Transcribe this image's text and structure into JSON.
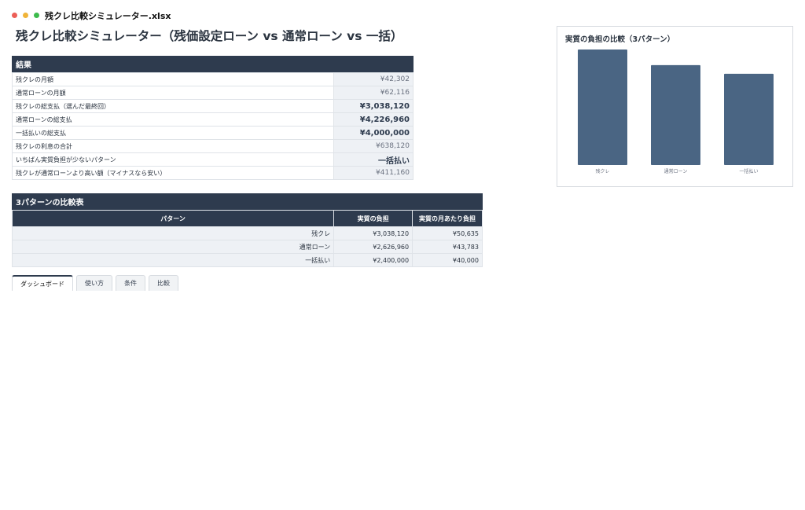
{
  "window": {
    "filename": "残クレ比較シミュレーター.xlsx"
  },
  "page": {
    "title": "残クレ比較シミュレーター（残価設定ローン vs 通常ローン vs 一括）"
  },
  "results": {
    "header": "結果",
    "rows": [
      {
        "label": "残クレの月額",
        "value": "¥42,302",
        "strong": false
      },
      {
        "label": "通常ローンの月額",
        "value": "¥62,116",
        "strong": false
      },
      {
        "label": "残クレの総支払（選んだ最終回）",
        "value": "¥3,038,120",
        "strong": true
      },
      {
        "label": "通常ローンの総支払",
        "value": "¥4,226,960",
        "strong": true
      },
      {
        "label": "一括払いの総支払",
        "value": "¥4,000,000",
        "strong": true
      },
      {
        "label": "残クレの利息の合計",
        "value": "¥638,120",
        "strong": false
      },
      {
        "label": "いちばん実質負担が少ないパターン",
        "value": "一括払い",
        "strong": true
      },
      {
        "label": "残クレが通常ローンより高い額（マイナスなら安い）",
        "value": "¥411,160",
        "strong": false
      }
    ]
  },
  "comparison": {
    "header": "3パターンの比較表",
    "columns": [
      "パターン",
      "実質の負担",
      "実質の月あたり負担"
    ],
    "rows": [
      [
        "残クレ",
        "¥3,038,120",
        "¥50,635"
      ],
      [
        "通常ローン",
        "¥2,626,960",
        "¥43,783"
      ],
      [
        "一括払い",
        "¥2,400,000",
        "¥40,000"
      ]
    ]
  },
  "tabs": [
    {
      "label": "ダッシュボード",
      "active": true
    },
    {
      "label": "使い方",
      "active": false
    },
    {
      "label": "条件",
      "active": false
    },
    {
      "label": "比較",
      "active": false
    }
  ],
  "chart_data": {
    "type": "bar",
    "title": "実質の負担の比較（3パターン）",
    "categories": [
      "残クレ",
      "通常ローン",
      "一括払い"
    ],
    "values": [
      3038120,
      2626960,
      2400000
    ],
    "ylim": [
      0,
      3100000
    ],
    "grid": false,
    "color": "#4a6583"
  }
}
